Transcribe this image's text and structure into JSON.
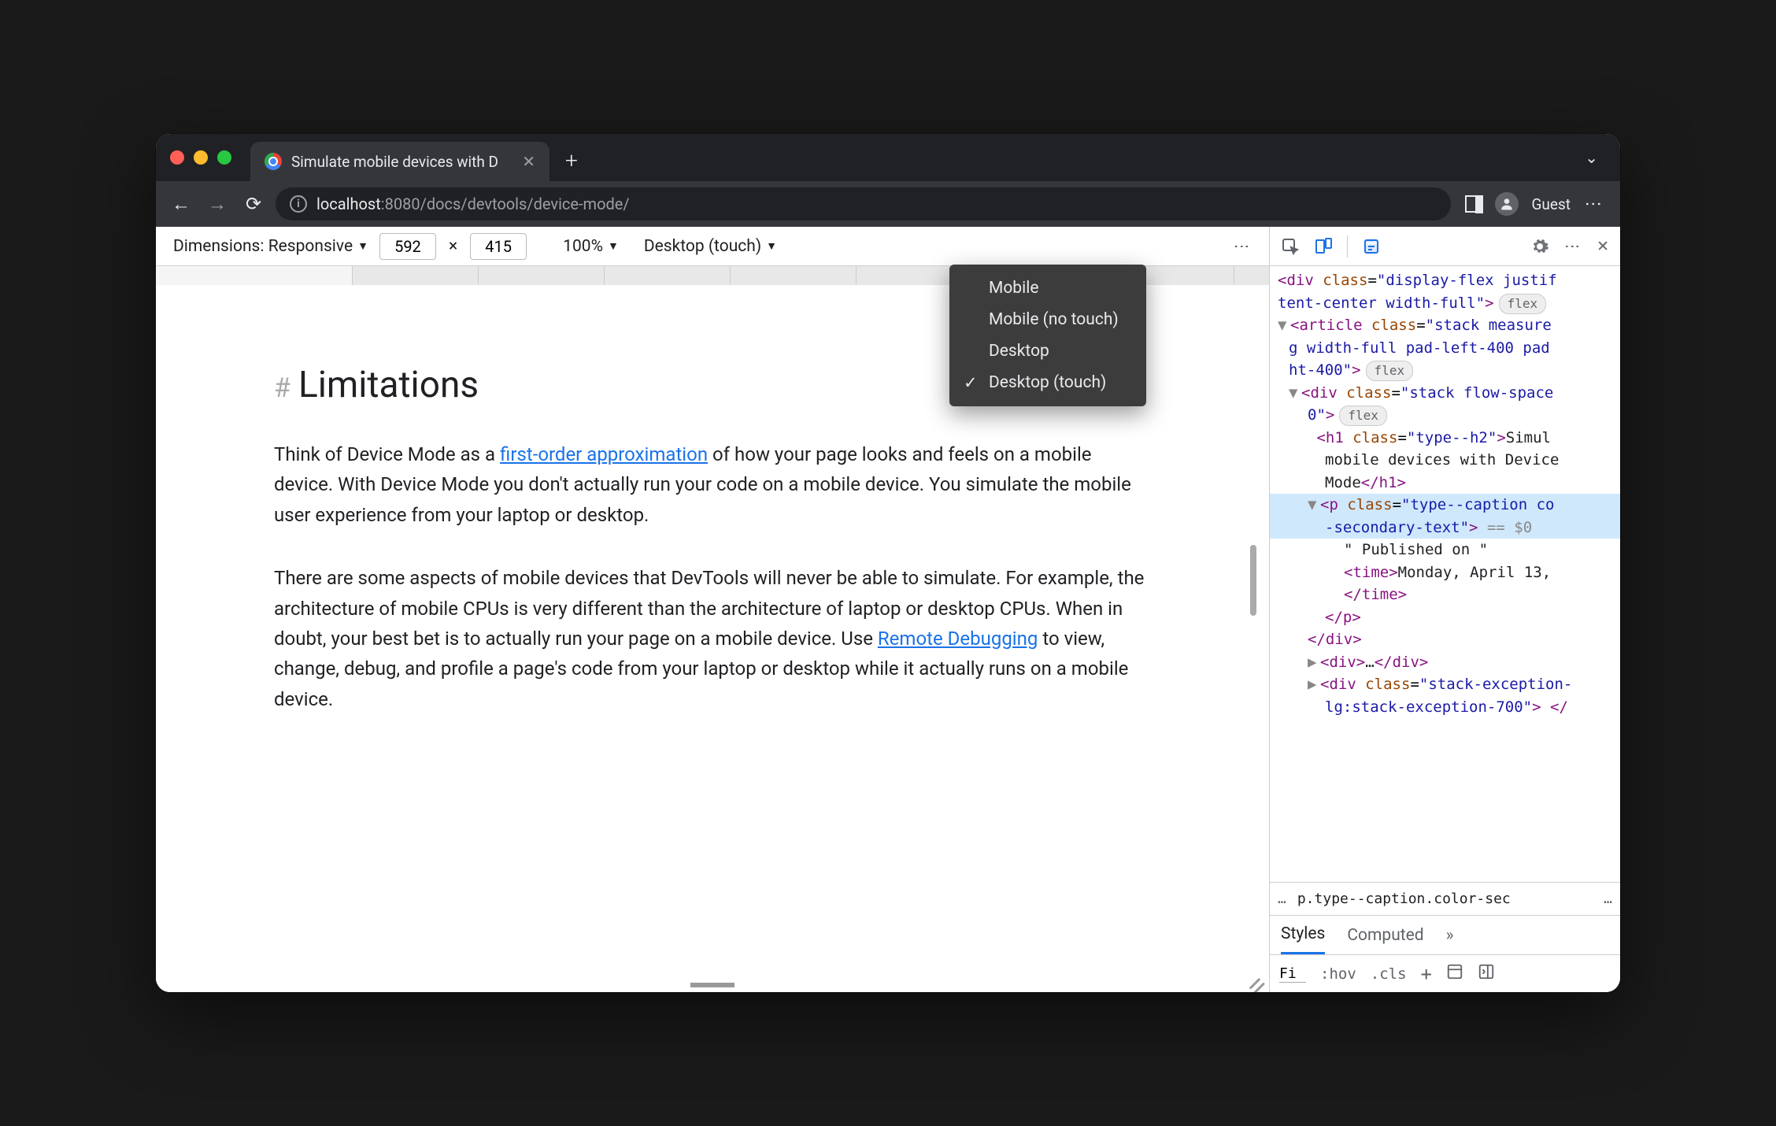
{
  "tab": {
    "title": "Simulate mobile devices with D"
  },
  "addr": {
    "host": "localhost",
    "port": ":8080",
    "path": "/docs/devtools/device-mode/",
    "guest": "Guest"
  },
  "device_toolbar": {
    "dimensions_label": "Dimensions: Responsive",
    "width": "592",
    "height": "415",
    "x": "×",
    "zoom": "100%",
    "device_type": "Desktop (touch)"
  },
  "device_type_menu": {
    "items": [
      "Mobile",
      "Mobile (no touch)",
      "Desktop",
      "Desktop (touch)"
    ],
    "selected_index": 3
  },
  "page": {
    "hash": "#",
    "heading": "Limitations",
    "p1_a": "Think of Device Mode as a ",
    "p1_link": "first-order approximation",
    "p1_b": " of how your page looks and feels on a mobile device. With Device Mode you don't actually run your code on a mobile device. You simulate the mobile user experience from your laptop or desktop.",
    "p2_a": "There are some aspects of mobile devices that DevTools will never be able to simulate. For example, the architecture of mobile CPUs is very different than the architecture of laptop or desktop CPUs. When in doubt, your best bet is to actually run your page on a mobile device. Use ",
    "p2_link": "Remote Debugging",
    "p2_b": " to view, change, debug, and profile a page's code from your laptop or desktop while it actually runs on a mobile device."
  },
  "dom": {
    "l1": "div",
    "l1_class": "display-flex justif",
    "l1b": "tent-center width-full",
    "flex": "flex",
    "l2": "article",
    "l2_class": "stack measure",
    "l2b": "g width-full pad-left-400 pad",
    "l2c": "ht-400",
    "l3": "div",
    "l3_class": "stack flow-space",
    "l3b": "0",
    "l4": "h1",
    "l4_class": "type--h2",
    "l4_txt": "Simul",
    "l4_txt2": "mobile devices with Device",
    "l4_txt3": "Mode",
    "l5": "p",
    "l5_class": "type--caption co",
    "l5b": "-secondary-text",
    "eq0": " == $0",
    "l6_txt": "\" Published on \"",
    "l7": "time",
    "l7_txt": "Monday, April 13,",
    "l8": "div",
    "l8b": "…",
    "l9": "div",
    "l9_class": "stack-exception-",
    "l9b": "lg:stack-exception-700"
  },
  "crumb": {
    "dots": "…",
    "sel": "p.type--caption.color-sec",
    "dots2": "…"
  },
  "styles": {
    "tab_styles": "Styles",
    "tab_computed": "Computed",
    "more": "»",
    "filter": "Fi",
    "hov": ":hov",
    "cls": ".cls"
  }
}
